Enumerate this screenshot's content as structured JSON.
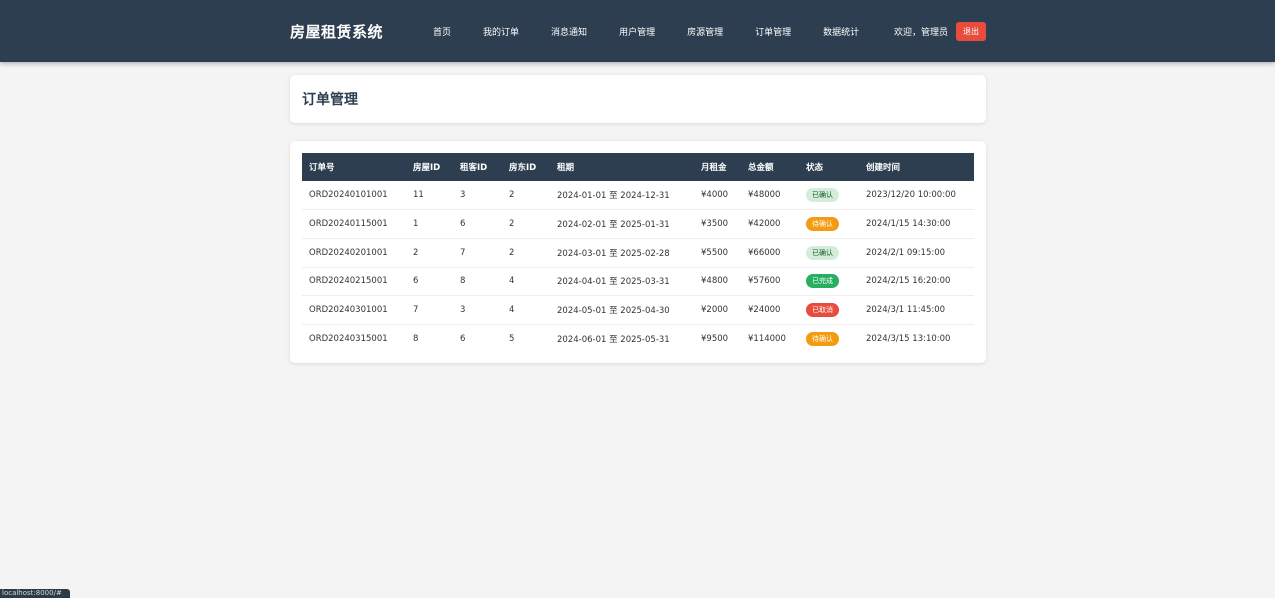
{
  "header": {
    "brand": "房屋租赁系统",
    "nav": [
      "首页",
      "我的订单",
      "消息通知",
      "用户管理",
      "房源管理",
      "订单管理",
      "数据统计"
    ],
    "welcome": "欢迎，管理员",
    "logout": "退出"
  },
  "page": {
    "title": "订单管理"
  },
  "table": {
    "columns": [
      "订单号",
      "房屋ID",
      "租客ID",
      "房东ID",
      "租期",
      "月租金",
      "总金额",
      "状态",
      "创建时间"
    ],
    "rows": [
      [
        "ORD20240101001",
        "11",
        "3",
        "2",
        "2024-01-01 至 2024-12-31",
        "¥4000",
        "¥48000",
        "已确认",
        "2023/12/20 10:00:00"
      ],
      [
        "ORD20240115001",
        "1",
        "6",
        "2",
        "2024-02-01 至 2025-01-31",
        "¥3500",
        "¥42000",
        "待确认",
        "2024/1/15 14:30:00"
      ],
      [
        "ORD20240201001",
        "2",
        "7",
        "2",
        "2024-03-01 至 2025-02-28",
        "¥5500",
        "¥66000",
        "已确认",
        "2024/2/1 09:15:00"
      ],
      [
        "ORD20240215001",
        "6",
        "8",
        "4",
        "2024-04-01 至 2025-03-31",
        "¥4800",
        "¥57600",
        "已完成",
        "2024/2/15 16:20:00"
      ],
      [
        "ORD20240301001",
        "7",
        "3",
        "4",
        "2024-05-01 至 2025-04-30",
        "¥2000",
        "¥24000",
        "已取消",
        "2024/3/1 11:45:00"
      ],
      [
        "ORD20240315001",
        "8",
        "6",
        "5",
        "2024-06-01 至 2025-05-31",
        "¥9500",
        "¥114000",
        "待确认",
        "2024/3/15 13:10:00"
      ]
    ]
  },
  "status_bar": {
    "url": "localhost:8000/#"
  },
  "colors": {
    "navbar": "#2c3e50",
    "confirmed": "#d4edda",
    "pending": "#f39c12",
    "completed": "#27ae60",
    "cancelled": "#e74c3c"
  }
}
